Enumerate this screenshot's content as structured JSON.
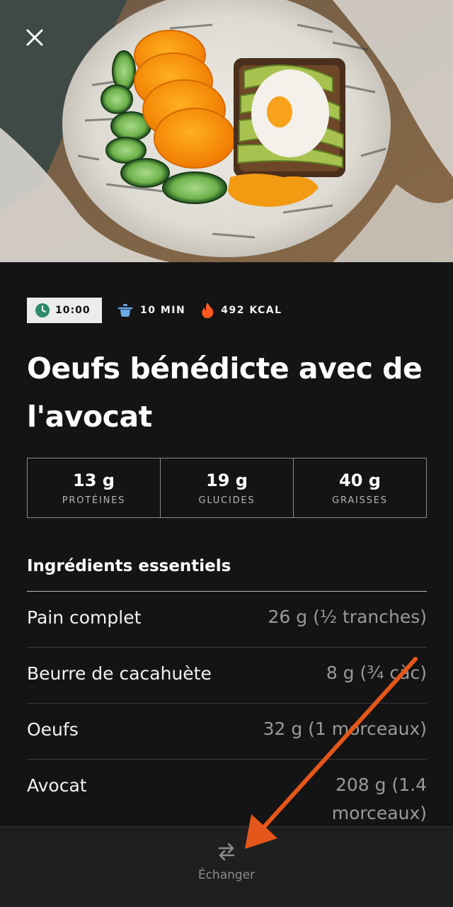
{
  "header": {
    "close_icon": "close-icon",
    "image_icon": "food-photo"
  },
  "meta": {
    "time": "10:00",
    "time_icon": "clock-icon",
    "duration": "10 MIN",
    "duration_icon": "pot-icon",
    "calories": "492 KCAL",
    "calories_icon": "flame-icon"
  },
  "recipe": {
    "title": "Oeufs bénédicte avec de l'avocat"
  },
  "macros": [
    {
      "value": "13 g",
      "label": "PROTÉINES"
    },
    {
      "value": "19 g",
      "label": "GLUCIDES"
    },
    {
      "value": "40 g",
      "label": "GRAISSES"
    }
  ],
  "ingredients": {
    "title": "Ingrédients essentiels",
    "items": [
      {
        "name": "Pain complet",
        "amount": "26 g (½ tranches)"
      },
      {
        "name": "Beurre de cacahuète",
        "amount": "8 g (¾ càc)"
      },
      {
        "name": "Oeufs",
        "amount": "32 g (1 morceaux)"
      },
      {
        "name": "Avocat",
        "amount": "208 g (1.4 morceaux)"
      }
    ]
  },
  "bottom": {
    "swap_label": "Échanger",
    "swap_icon": "swap-arrows-icon"
  },
  "colors": {
    "background": "#141414",
    "accent_orange": "#e5561a",
    "clock_green": "#2e8b6a",
    "pot_blue": "#6aa8e8",
    "flame_orange": "#ff5a1f"
  }
}
